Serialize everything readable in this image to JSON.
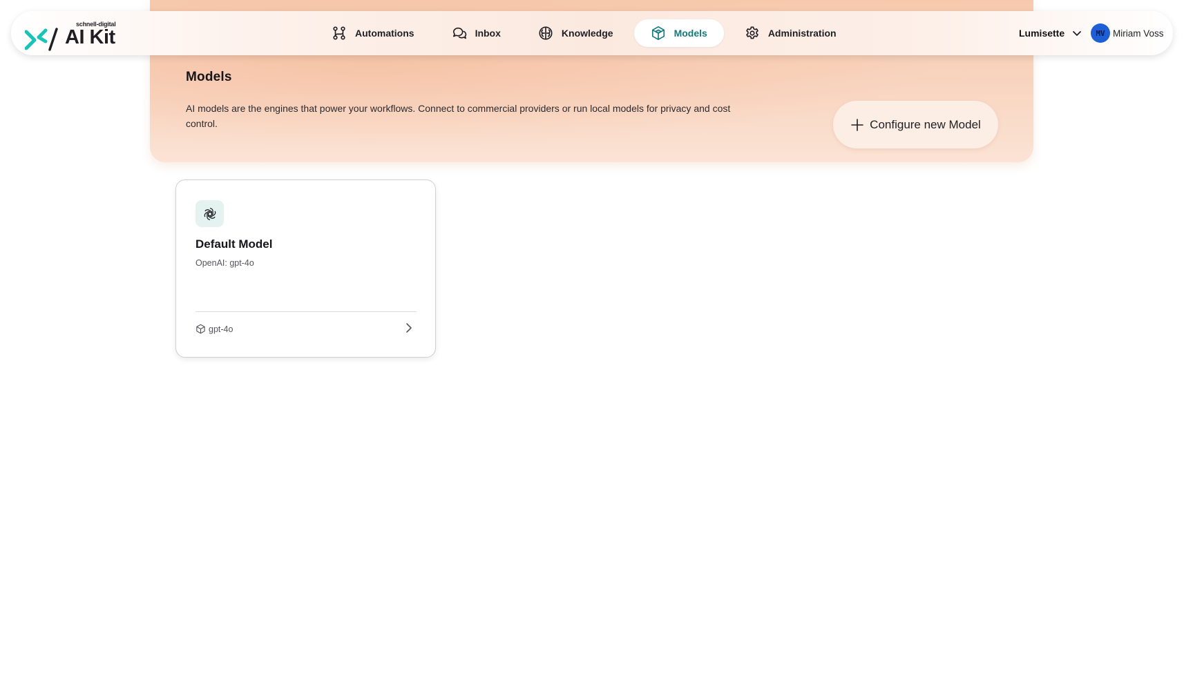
{
  "app": {
    "brand_small": "schnell-digital",
    "brand_main": "AI Kit"
  },
  "nav": {
    "items": [
      {
        "label": "Automations",
        "icon": "workflow-icon",
        "active": false
      },
      {
        "label": "Inbox",
        "icon": "chat-bubbles-icon",
        "active": false
      },
      {
        "label": "Knowledge",
        "icon": "brain-icon",
        "active": false
      },
      {
        "label": "Models",
        "icon": "cube-icon",
        "active": true
      },
      {
        "label": "Administration",
        "icon": "gear-icon",
        "active": false
      }
    ]
  },
  "org": {
    "name": "Lumisette",
    "icon": "chevron-down-icon"
  },
  "user": {
    "initials": "MV",
    "name": "Miriam Voss"
  },
  "header": {
    "title": "Models",
    "description": "AI models are the engines that power your workflows. Connect to commercial providers or run local models for privacy and cost control.",
    "cta_label": "Configure new Model",
    "cta_icon": "plus-icon"
  },
  "models": [
    {
      "name": "Default Model",
      "provider_line": "OpenAI: gpt-4o",
      "model_id": "gpt-4o",
      "icon": "openai-logo-icon"
    }
  ],
  "colors": {
    "accent": "#127a7c",
    "hero": "#f6c9ad",
    "avatar": "#1f5fd6"
  }
}
